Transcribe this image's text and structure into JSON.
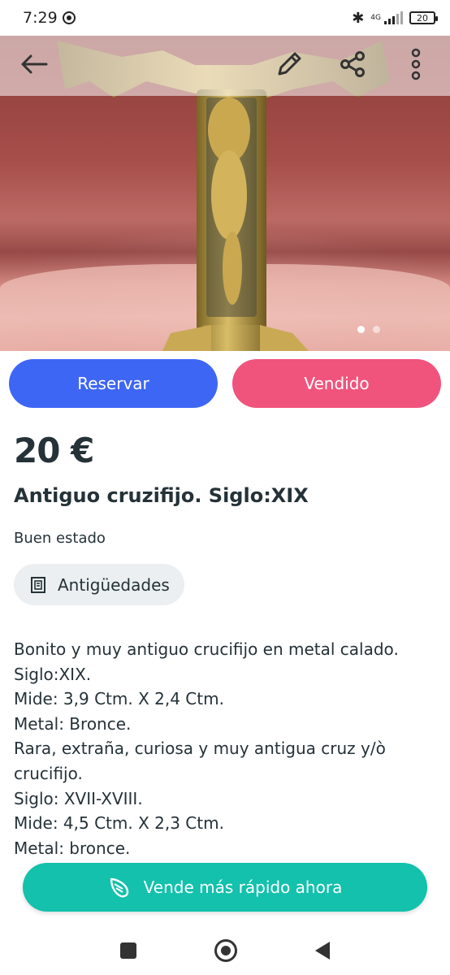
{
  "status_bar": {
    "time": "7:29",
    "network": "4G",
    "battery": "20"
  },
  "toolbar": {
    "icons": [
      "back-arrow-icon",
      "edit-pencil-icon",
      "share-icon",
      "more-vert-icon"
    ]
  },
  "gallery": {
    "pages": 2,
    "active_page": 1
  },
  "actions": {
    "reserve_label": "Reservar",
    "sold_label": "Vendido"
  },
  "listing": {
    "price": "20 €",
    "title": "Antiguo cruzifijo. Siglo:XIX",
    "condition": "Buen estado",
    "category": "Antigüedades",
    "category_icon": "antiques-frame-icon",
    "description_lines": [
      "Bonito y muy antiguo crucifijo en metal calado.",
      "Siglo:XIX.",
      "Mide: 3,9 Ctm. X 2,4 Ctm.",
      "Metal: Bronce.",
      "Rara, extraña, curiosa y muy antigua cruz y/ò",
      "crucifijo.",
      "Siglo: XVII-XVIII.",
      "Mide: 4,5 Ctm. X 2,3 Ctm.",
      "Metal: bronce."
    ]
  },
  "promo": {
    "sell_fast_label": "Vende más rápido ahora",
    "icon": "wing-icon"
  },
  "colors": {
    "reserve": "#3e66f5",
    "sold": "#f0547d",
    "promo": "#13c1ac",
    "text": "#253238",
    "chip_bg": "#eceff1"
  }
}
